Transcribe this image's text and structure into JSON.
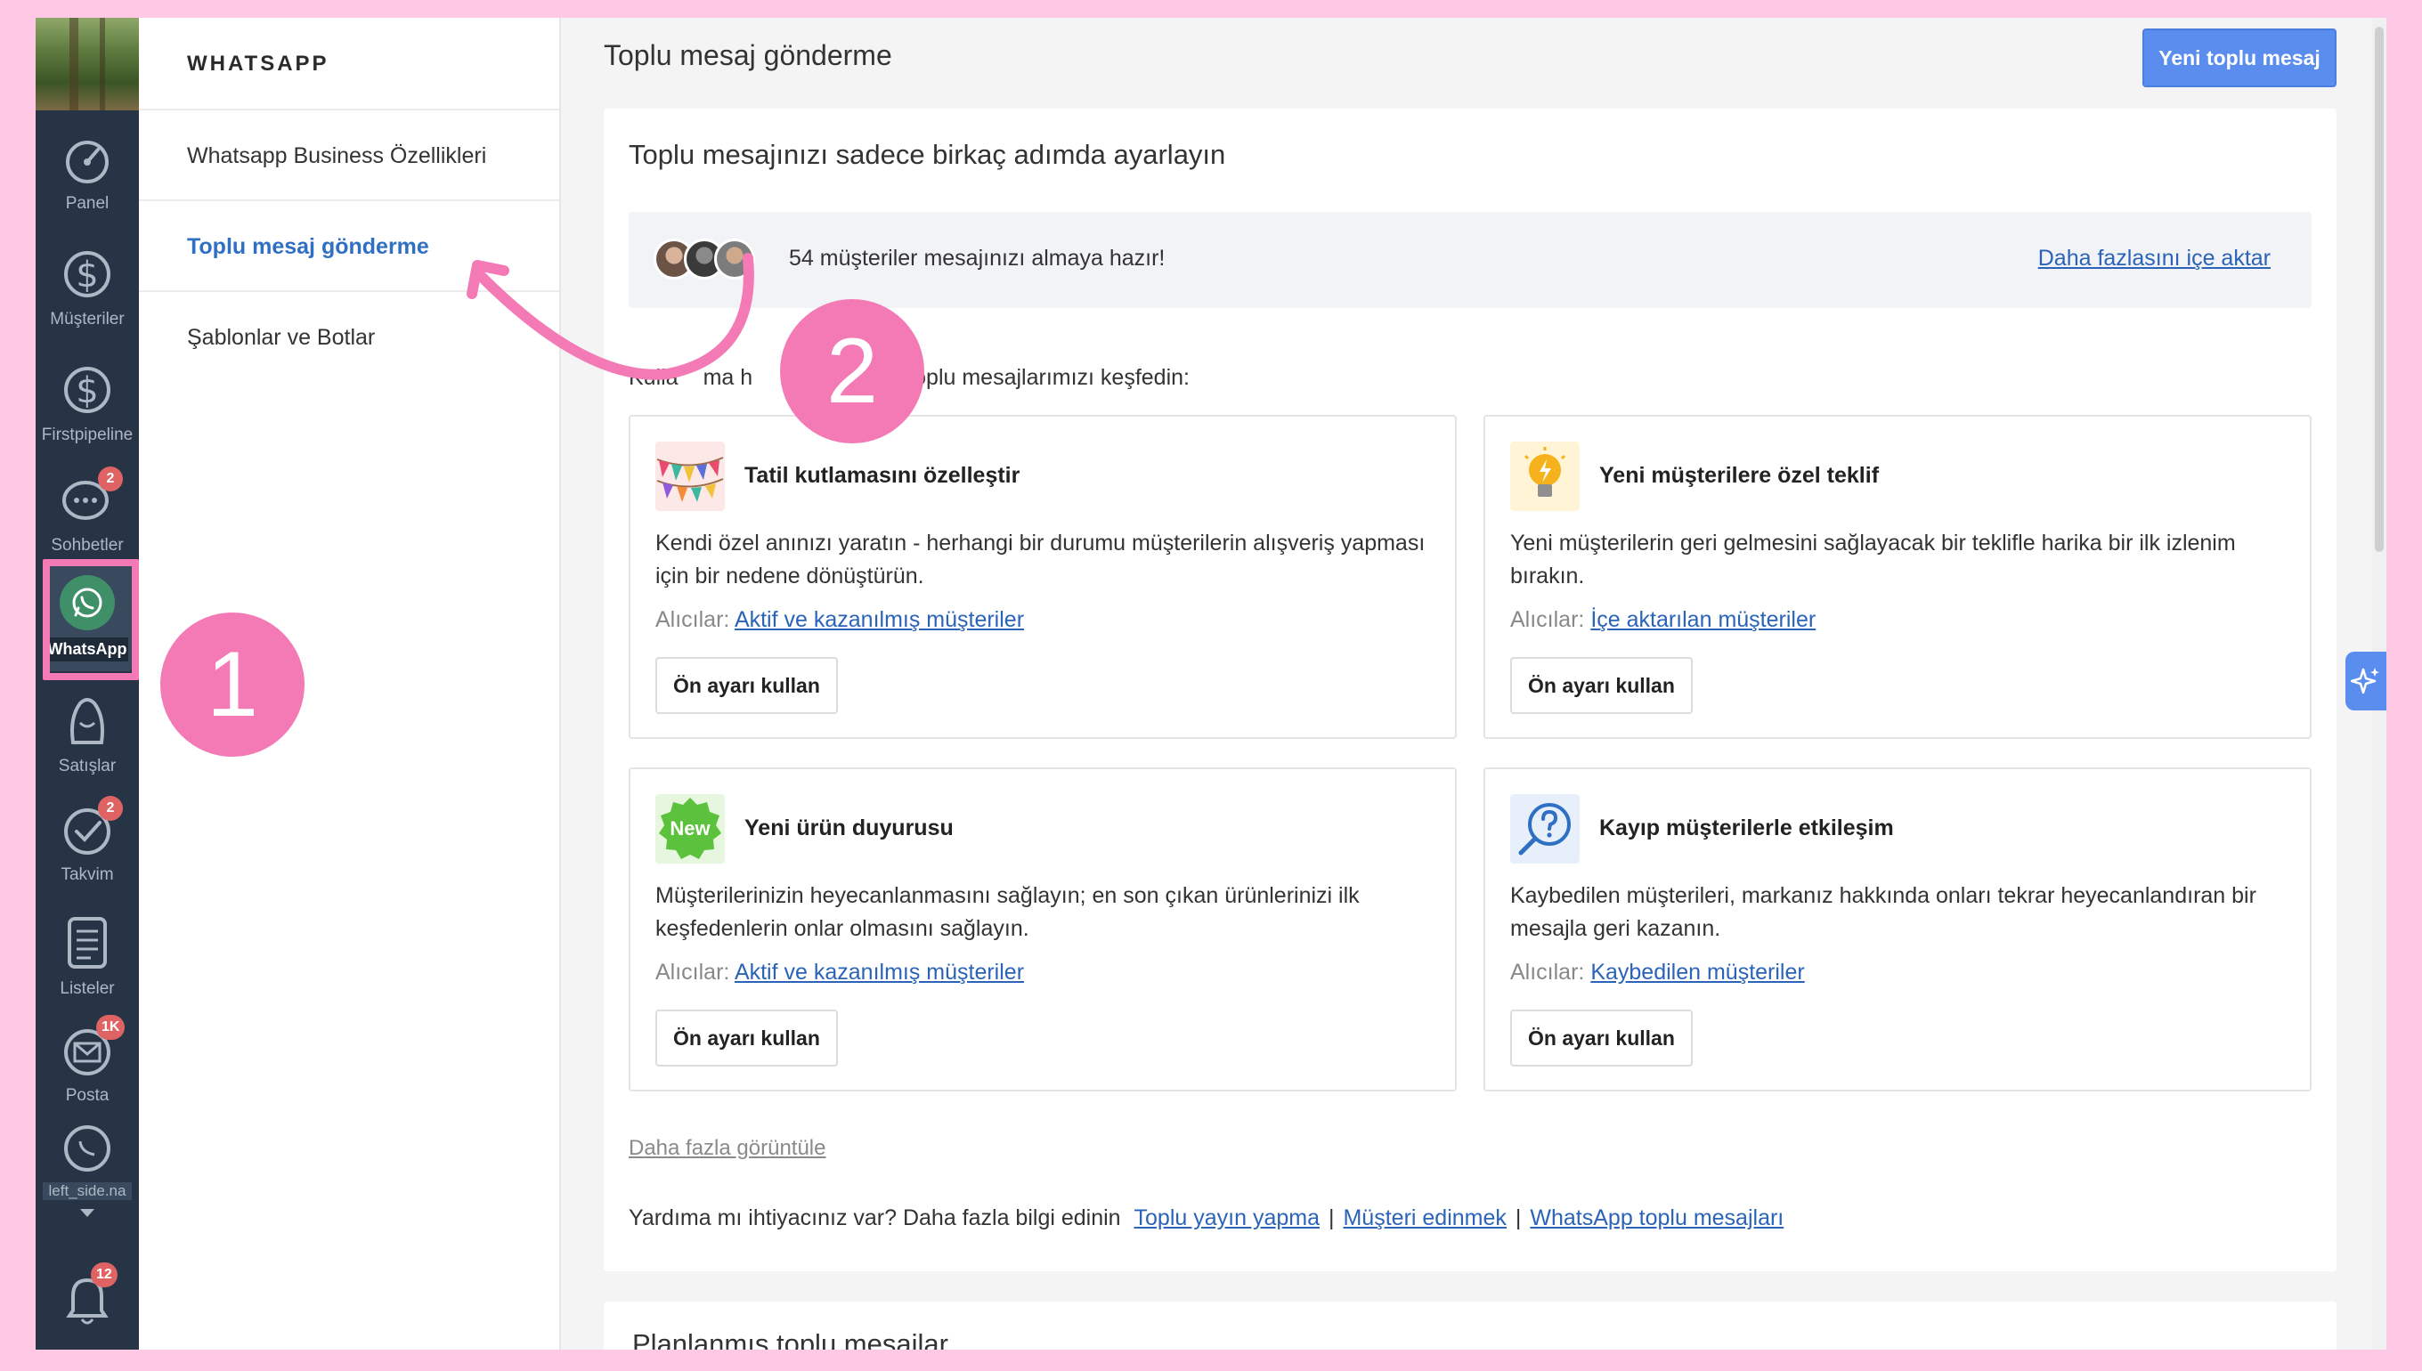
{
  "nav": {
    "items": [
      {
        "label": "Panel",
        "icon": "dashboard-icon"
      },
      {
        "label": "Müşteriler",
        "icon": "dollar-icon"
      },
      {
        "label": "Firstpipeline",
        "icon": "dollar-icon"
      },
      {
        "label": "Sohbetler",
        "icon": "chat-icon",
        "badge": "2"
      },
      {
        "label": "WhatsApp",
        "icon": "whatsapp-icon"
      },
      {
        "label": "Satışlar",
        "icon": "sales-icon"
      },
      {
        "label": "Takvim",
        "icon": "check-icon",
        "badge": "2"
      },
      {
        "label": "Listeler",
        "icon": "list-icon"
      },
      {
        "label": "Posta",
        "icon": "mail-icon",
        "badge": "1K"
      },
      {
        "label": "left_side.na",
        "icon": "whatsapp-icon"
      },
      {
        "badge": "12",
        "icon": "bell-icon"
      }
    ]
  },
  "subnav": {
    "title": "WHATSAPP",
    "items": [
      {
        "label": "Whatsapp Business Özellikleri"
      },
      {
        "label": "Toplu mesaj gönderme"
      },
      {
        "label": "Şablonlar ve Botlar"
      }
    ]
  },
  "header": {
    "title": "Toplu mesaj gönderme",
    "primary_button": "Yeni toplu mesaj"
  },
  "setup": {
    "title": "Toplu mesajınızı sadece birkaç adımda ayarlayın",
    "import_text": "54 müşteriler mesajınızı almaya hazır!",
    "import_link": "Daha fazlasını içe aktar",
    "explore_text_start": "Kulla",
    "explore_text_mid": "ma h",
    "explore_text_end": "toplu mesajlarımızı keşfedin:"
  },
  "templates": [
    {
      "title": "Tatil kutlamasını özelleştir",
      "description": "Kendi özel anınızı yaratın - herhangi bir durumu müşterilerin alışveriş yapması için bir nedene dönüştürün.",
      "recipients_label": "Alıcılar:",
      "recipients_link": "Aktif ve kazanılmış müşteriler",
      "button": "Ön ayarı kullan",
      "icon": "party-flags-icon"
    },
    {
      "title": "Yeni müşterilere özel teklif",
      "description": "Yeni müşterilerin geri gelmesini sağlayacak bir teklifle harika bir ilk izlenim bırakın.",
      "recipients_label": "Alıcılar:",
      "recipients_link": "İçe aktarılan müşteriler",
      "button": "Ön ayarı kullan",
      "icon": "lightbulb-icon"
    },
    {
      "title": "Yeni ürün duyurusu",
      "description": "Müşterilerinizin heyecanlanmasını sağlayın; en son çıkan ürünlerinizi ilk keşfedenlerin onlar olmasını sağlayın.",
      "recipients_label": "Alıcılar:",
      "recipients_link": "Aktif ve kazanılmış müşteriler",
      "button": "Ön ayarı kullan",
      "icon": "new-badge-icon",
      "icon_text": "New"
    },
    {
      "title": "Kayıp müşterilerle etkileşim",
      "description": "Kaybedilen müşterileri, markanız hakkında onları tekrar heyecanlandıran bir mesajla geri kazanın.",
      "recipients_label": "Alıcılar:",
      "recipients_link": "Kaybedilen müşteriler",
      "button": "Ön ayarı kullan",
      "icon": "question-search-icon"
    }
  ],
  "more_link": "Daha fazla görüntüle",
  "help": {
    "text": "Yardıma mı ihtiyacınız var? Daha fazla bilgi edinin",
    "links": [
      "Toplu yayın yapma",
      "Müşteri edinmek",
      "WhatsApp toplu mesajları"
    ],
    "separator": "|"
  },
  "scheduled": {
    "title": "Planlanmış toplu mesajlar"
  },
  "annotations": {
    "step1": "1",
    "step2": "2"
  },
  "colors": {
    "accent": "#5b8def",
    "link": "#2a63b8",
    "highlight": "#f47ab6",
    "nav_bg": "#263446"
  }
}
